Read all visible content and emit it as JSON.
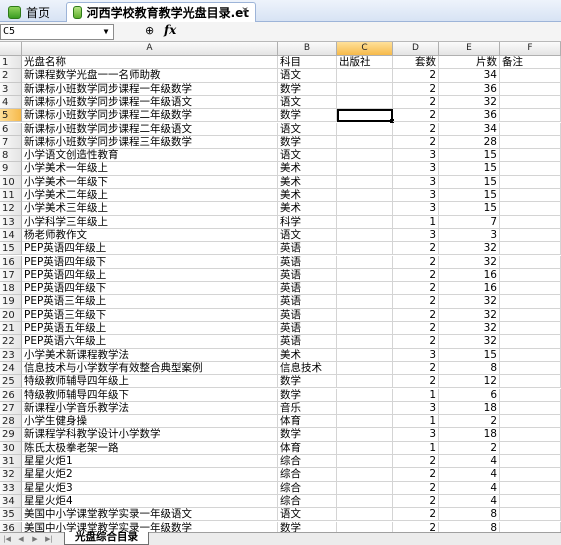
{
  "tabs": [
    {
      "label": "首页"
    },
    {
      "label": "河西学校教育教学光盘目录.et"
    }
  ],
  "formula_bar": {
    "name_box": "C5",
    "fx": "fx",
    "zoom_icon": "magnifier-icon",
    "value": ""
  },
  "grid": {
    "columns": [
      "A",
      "B",
      "C",
      "D",
      "E",
      "F"
    ],
    "active_column": "C",
    "active_row": 5,
    "rows": [
      {
        "n": "1",
        "a": "光盘名称",
        "b": "科目",
        "c": "出版社",
        "d": "套数",
        "e": "片数",
        "f": "备注"
      },
      {
        "n": "2",
        "a": "新课程数学光盘一一名师助教",
        "b": "语文",
        "c": "",
        "d": "2",
        "e": "34",
        "f": ""
      },
      {
        "n": "3",
        "a": "新课标小班数学同步课程一年级数学",
        "b": "数学",
        "c": "",
        "d": "2",
        "e": "36",
        "f": ""
      },
      {
        "n": "4",
        "a": "新课标小班数学同步课程一年级语文",
        "b": "语文",
        "c": "",
        "d": "2",
        "e": "32",
        "f": ""
      },
      {
        "n": "5",
        "a": "新课标小班数学同步课程二年级数学",
        "b": "数学",
        "c": "",
        "d": "2",
        "e": "36",
        "f": ""
      },
      {
        "n": "6",
        "a": "新课标小班数学同步课程二年级语文",
        "b": "语文",
        "c": "",
        "d": "2",
        "e": "34",
        "f": ""
      },
      {
        "n": "7",
        "a": "新课标小班数学同步课程三年级数学",
        "b": "数学",
        "c": "",
        "d": "2",
        "e": "28",
        "f": ""
      },
      {
        "n": "8",
        "a": "小学语文创造性教育",
        "b": "语文",
        "c": "",
        "d": "3",
        "e": "15",
        "f": ""
      },
      {
        "n": "9",
        "a": "小学美术一年级上",
        "b": "美术",
        "c": "",
        "d": "3",
        "e": "15",
        "f": ""
      },
      {
        "n": "10",
        "a": "小学美术一年级下",
        "b": "美术",
        "c": "",
        "d": "3",
        "e": "15",
        "f": ""
      },
      {
        "n": "11",
        "a": "小学美术二年级上",
        "b": "美术",
        "c": "",
        "d": "3",
        "e": "15",
        "f": ""
      },
      {
        "n": "12",
        "a": "小学美术三年级上",
        "b": "美术",
        "c": "",
        "d": "3",
        "e": "15",
        "f": ""
      },
      {
        "n": "13",
        "a": "小学科学三年级上",
        "b": "科学",
        "c": "",
        "d": "1",
        "e": "7",
        "f": ""
      },
      {
        "n": "14",
        "a": "杨老师教作文",
        "b": "语文",
        "c": "",
        "d": "3",
        "e": "3",
        "f": ""
      },
      {
        "n": "15",
        "a": "PEP英语四年级上",
        "b": "英语",
        "c": "",
        "d": "2",
        "e": "32",
        "f": ""
      },
      {
        "n": "16",
        "a": "PEP英语四年级下",
        "b": "英语",
        "c": "",
        "d": "2",
        "e": "32",
        "f": ""
      },
      {
        "n": "17",
        "a": "PEP英语四年级上",
        "b": "英语",
        "c": "",
        "d": "2",
        "e": "16",
        "f": ""
      },
      {
        "n": "18",
        "a": "PEP英语四年级下",
        "b": "英语",
        "c": "",
        "d": "2",
        "e": "16",
        "f": ""
      },
      {
        "n": "19",
        "a": "PEP英语三年级上",
        "b": "英语",
        "c": "",
        "d": "2",
        "e": "32",
        "f": ""
      },
      {
        "n": "20",
        "a": "PEP英语三年级下",
        "b": "英语",
        "c": "",
        "d": "2",
        "e": "32",
        "f": ""
      },
      {
        "n": "21",
        "a": "PEP英语五年级上",
        "b": "英语",
        "c": "",
        "d": "2",
        "e": "32",
        "f": ""
      },
      {
        "n": "22",
        "a": "PEP英语六年级上",
        "b": "英语",
        "c": "",
        "d": "2",
        "e": "32",
        "f": ""
      },
      {
        "n": "23",
        "a": "小学美术新课程教学法",
        "b": "美术",
        "c": "",
        "d": "3",
        "e": "15",
        "f": ""
      },
      {
        "n": "24",
        "a": "信息技术与小学数学有效整合典型案例",
        "b": "信息技术",
        "c": "",
        "d": "2",
        "e": "8",
        "f": ""
      },
      {
        "n": "25",
        "a": "特级教师辅导四年级上",
        "b": "数学",
        "c": "",
        "d": "2",
        "e": "12",
        "f": ""
      },
      {
        "n": "26",
        "a": "特级教师辅导四年级下",
        "b": "数学",
        "c": "",
        "d": "1",
        "e": "6",
        "f": ""
      },
      {
        "n": "27",
        "a": "新课程小学音乐教学法",
        "b": "音乐",
        "c": "",
        "d": "3",
        "e": "18",
        "f": ""
      },
      {
        "n": "28",
        "a": "小学生健身操",
        "b": "体育",
        "c": "",
        "d": "1",
        "e": "2",
        "f": ""
      },
      {
        "n": "29",
        "a": "新课程学科教学设计小学数学",
        "b": "数学",
        "c": "",
        "d": "3",
        "e": "18",
        "f": ""
      },
      {
        "n": "30",
        "a": "陈氏太极拳老架一路",
        "b": "体育",
        "c": "",
        "d": "1",
        "e": "2",
        "f": ""
      },
      {
        "n": "31",
        "a": "星星火炬1",
        "b": "综合",
        "c": "",
        "d": "2",
        "e": "4",
        "f": ""
      },
      {
        "n": "32",
        "a": "星星火炬2",
        "b": "综合",
        "c": "",
        "d": "2",
        "e": "4",
        "f": ""
      },
      {
        "n": "33",
        "a": "星星火炬3",
        "b": "综合",
        "c": "",
        "d": "2",
        "e": "4",
        "f": ""
      },
      {
        "n": "34",
        "a": "星星火炬4",
        "b": "综合",
        "c": "",
        "d": "2",
        "e": "4",
        "f": ""
      },
      {
        "n": "35",
        "a": "美国中小学课堂教学实录一年级语文",
        "b": "语文",
        "c": "",
        "d": "2",
        "e": "8",
        "f": ""
      },
      {
        "n": "36",
        "a": "美国中小学课堂教学实录一年级数学",
        "b": "数学",
        "c": "",
        "d": "2",
        "e": "8",
        "f": ""
      }
    ]
  },
  "sheet_tabs": [
    {
      "label": "光盘综合目录"
    }
  ]
}
